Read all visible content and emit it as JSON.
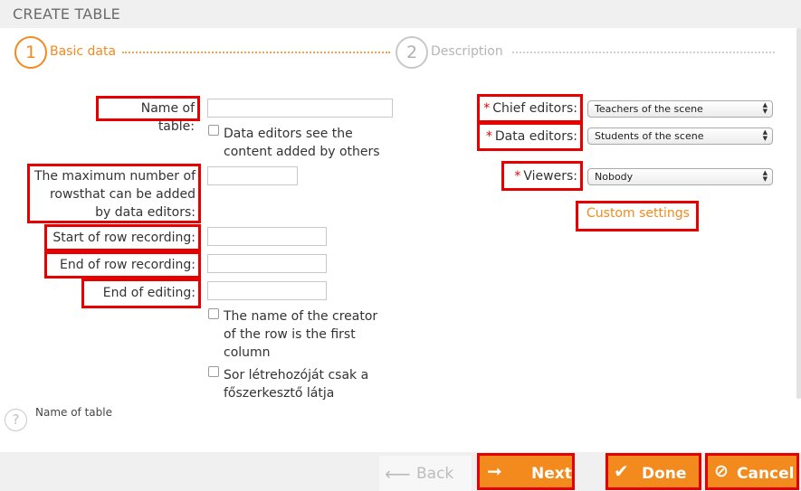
{
  "header": {
    "title": "CREATE TABLE"
  },
  "steps": [
    {
      "number": "1",
      "label": "Basic data"
    },
    {
      "number": "2",
      "label": "Description"
    }
  ],
  "form_left": {
    "name_of_table_label": "Name of table:",
    "data_editors_see_label": "Data editors see the content added by others",
    "max_rows_label": "The maximum number of rowsthat can be added by data editors:",
    "start_row_label": "Start of row recording:",
    "end_row_label": "End of row recording:",
    "end_editing_label": "End of editing:",
    "creator_first_col_label": "The name of the creator of the row is the first column",
    "only_chief_sees_label": "Sor létrehozóját csak a főszerkesztő látja"
  },
  "form_right": {
    "required_mark": "*",
    "chief_editors_label": "Chief editors:",
    "chief_editors_value": "Teachers of the scene",
    "data_editors_label": "Data editors:",
    "data_editors_value": "Students of the scene",
    "viewers_label": "Viewers:",
    "viewers_value": "Nobody",
    "custom_settings_link": "Custom settings"
  },
  "help": {
    "icon": "question-icon",
    "glyph": "?",
    "text": "Name of table"
  },
  "footer": {
    "back_label": "Back",
    "next_label": "Next",
    "done_label": "Done",
    "cancel_label": "Cancel"
  },
  "colors": {
    "accent": "#f28a1e",
    "highlight": "#e60000",
    "muted": "#b5b5b5"
  }
}
